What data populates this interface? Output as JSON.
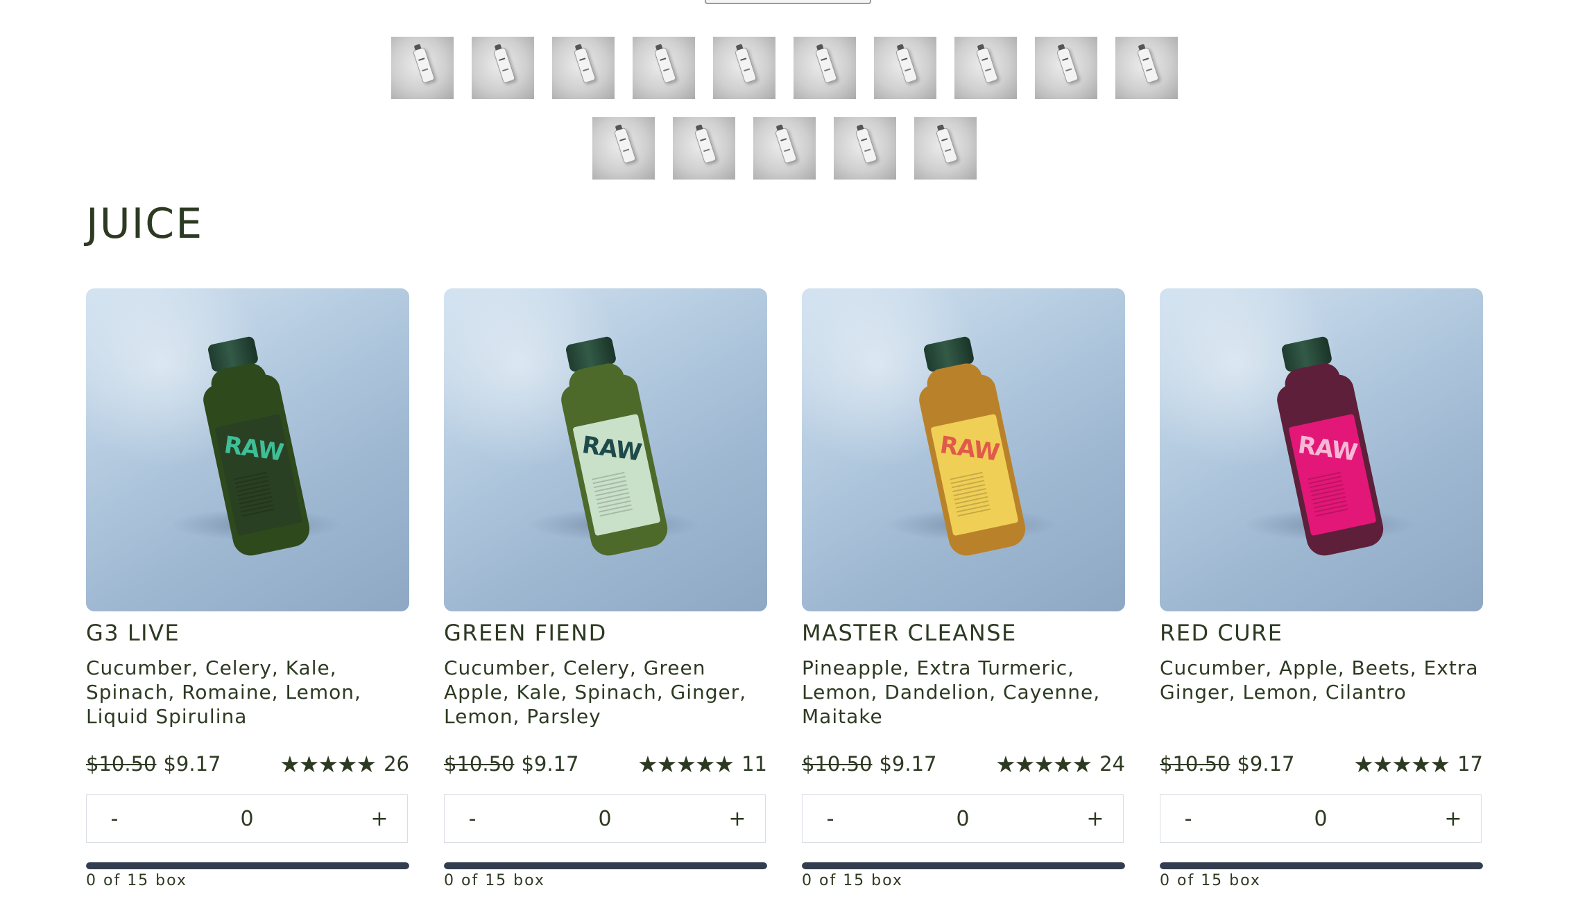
{
  "section_title": "JUICE",
  "thumbnails": {
    "row1_count": 10,
    "row2_count": 5
  },
  "products": [
    {
      "name": "G3 LIVE",
      "ingredients": "Cucumber, Celery, Kale, Spinach, Romaine, Lemon, Liquid Spirulina",
      "old_price": "$10.50",
      "price": "$9.17",
      "stars": "★★★★★",
      "reviews": "26",
      "decrement": "-",
      "quantity": "0",
      "increment": "+",
      "box_text": "0 of 15 box",
      "box_fill": 1.0,
      "bottle_label": "RAW",
      "colors": {
        "liquid": "#2e4a1d",
        "label": "#2b3f22",
        "logo": "#3fbf98"
      }
    },
    {
      "name": "GREEN FIEND",
      "ingredients": "Cucumber, Celery, Green Apple, Kale, Spinach, Ginger, Lemon, Parsley",
      "old_price": "$10.50",
      "price": "$9.17",
      "stars": "★★★★★",
      "reviews": "11",
      "decrement": "-",
      "quantity": "0",
      "increment": "+",
      "box_text": "0 of 15 box",
      "box_fill": 1.0,
      "bottle_label": "RAW",
      "colors": {
        "liquid": "#4d6a2a",
        "label": "#cfe6d0",
        "logo": "#1e4a4a"
      }
    },
    {
      "name": "MASTER CLEANSE",
      "ingredients": "Pineapple, Extra Turmeric, Lemon, Dandelion, Cayenne, Maitake",
      "old_price": "$10.50",
      "price": "$9.17",
      "stars": "★★★★★",
      "reviews": "24",
      "decrement": "-",
      "quantity": "0",
      "increment": "+",
      "box_text": "0 of 15 box",
      "box_fill": 1.0,
      "bottle_label": "RAW",
      "colors": {
        "liquid": "#b9822a",
        "label": "#f3d25a",
        "logo": "#e05a4a"
      }
    },
    {
      "name": "RED CURE",
      "ingredients": "Cucumber, Apple, Beets, Extra Ginger, Lemon, Cilantro",
      "old_price": "$10.50",
      "price": "$9.17",
      "stars": "★★★★★",
      "reviews": "17",
      "decrement": "-",
      "quantity": "0",
      "increment": "+",
      "box_text": "0 of 15 box",
      "box_fill": 1.0,
      "bottle_label": "RAW",
      "colors": {
        "liquid": "#5e1f3a",
        "label": "#e8177a",
        "logo": "#f7b8d6"
      }
    }
  ]
}
